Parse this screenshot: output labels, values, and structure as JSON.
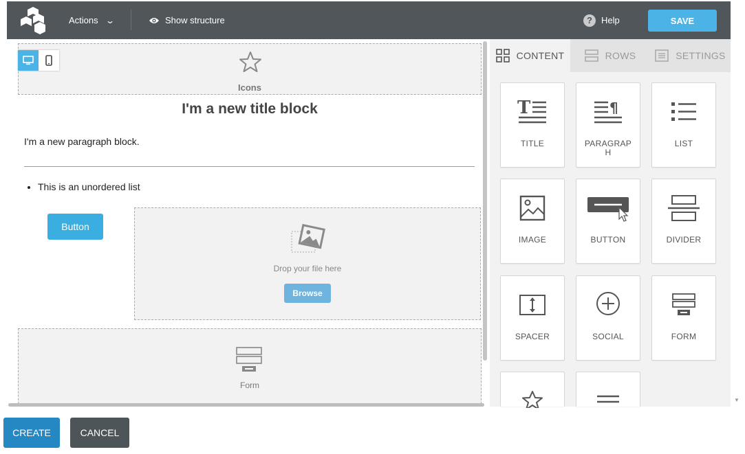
{
  "topbar": {
    "actions_label": "Actions",
    "show_structure_label": "Show structure",
    "help_label": "Help",
    "help_icon_glyph": "?",
    "save_label": "SAVE"
  },
  "canvas": {
    "icons_block_label": "Icons",
    "title_text": "I'm a new title block",
    "paragraph_text": "I'm a new paragraph block.",
    "list_items": [
      "This is an unordered list"
    ],
    "button_label": "Button",
    "drop_text": "Drop your file here",
    "browse_label": "Browse",
    "form_label": "Form"
  },
  "panel": {
    "tabs": [
      {
        "label": "CONTENT",
        "active": true
      },
      {
        "label": "ROWS",
        "active": false
      },
      {
        "label": "SETTINGS",
        "active": false
      }
    ],
    "tiles": [
      {
        "label": "TITLE",
        "icon": "title-icon"
      },
      {
        "label": "PARAGRAPH",
        "icon": "paragraph-icon"
      },
      {
        "label": "LIST",
        "icon": "list-icon"
      },
      {
        "label": "IMAGE",
        "icon": "image-icon"
      },
      {
        "label": "BUTTON",
        "icon": "button-icon"
      },
      {
        "label": "DIVIDER",
        "icon": "divider-icon"
      },
      {
        "label": "SPACER",
        "icon": "spacer-icon"
      },
      {
        "label": "SOCIAL",
        "icon": "social-icon"
      },
      {
        "label": "FORM",
        "icon": "form-icon"
      },
      {
        "label": "",
        "icon": "star-icon"
      },
      {
        "label": "",
        "icon": "menu-icon"
      }
    ]
  },
  "footer": {
    "create_label": "CREATE",
    "cancel_label": "CANCEL"
  },
  "colors": {
    "topbar_bg": "#505659",
    "accent": "#4cb3e6",
    "create_bg": "#2588c2",
    "cancel_bg": "#4d5559"
  }
}
